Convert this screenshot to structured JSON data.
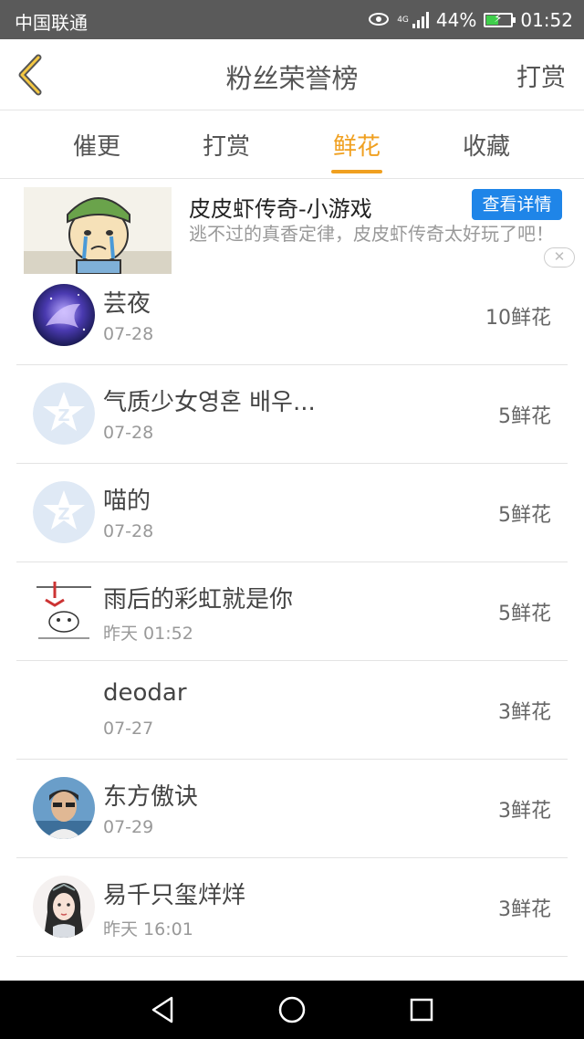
{
  "status_bar": {
    "carrier": "中国联通",
    "network": "4G",
    "battery": "44%",
    "battery_level": 0.44,
    "time": "01:52",
    "icons": [
      "eye-icon",
      "signal-icon",
      "battery-charging-icon"
    ]
  },
  "header": {
    "title": "粉丝荣誉榜",
    "right_action": "打赏",
    "back_icon": "chevron-left-icon",
    "accent_color": "#f0a020"
  },
  "tabs": [
    {
      "label": "催更",
      "active": false
    },
    {
      "label": "打赏",
      "active": false
    },
    {
      "label": "鲜花",
      "active": true
    },
    {
      "label": "收藏",
      "active": false
    }
  ],
  "ad": {
    "title": "皮皮虾传奇-小游戏",
    "description": "逃不过的真香定律，皮皮虾传奇太好玩了吧！",
    "button": "查看详情",
    "button_color": "#1f85e8",
    "close_icon": "close-icon"
  },
  "fans": [
    {
      "name": "芸夜",
      "date": "07-28",
      "count": "10鲜花",
      "avatar": "galaxy-avatar"
    },
    {
      "name": "气质少女영혼 배우...",
      "date": "07-28",
      "count": "5鲜花",
      "avatar": "default-qq-avatar"
    },
    {
      "name": "喵的",
      "date": "07-28",
      "count": "5鲜花",
      "avatar": "default-qq-avatar"
    },
    {
      "name": "雨后的彩虹就是你",
      "date": "昨天 01:52",
      "count": "5鲜花",
      "avatar": "sketch-avatar"
    },
    {
      "name": "deodar",
      "date": "07-27",
      "count": "3鲜花",
      "avatar": "blank-avatar"
    },
    {
      "name": "东方傲诀",
      "date": "07-29",
      "count": "3鲜花",
      "avatar": "photo-avatar"
    },
    {
      "name": "易千只玺烊烊",
      "date": "昨天 16:01",
      "count": "3鲜花",
      "avatar": "anime-avatar"
    }
  ],
  "navbar": {
    "icons": [
      "back-triangle-icon",
      "home-circle-icon",
      "recents-square-icon"
    ]
  }
}
